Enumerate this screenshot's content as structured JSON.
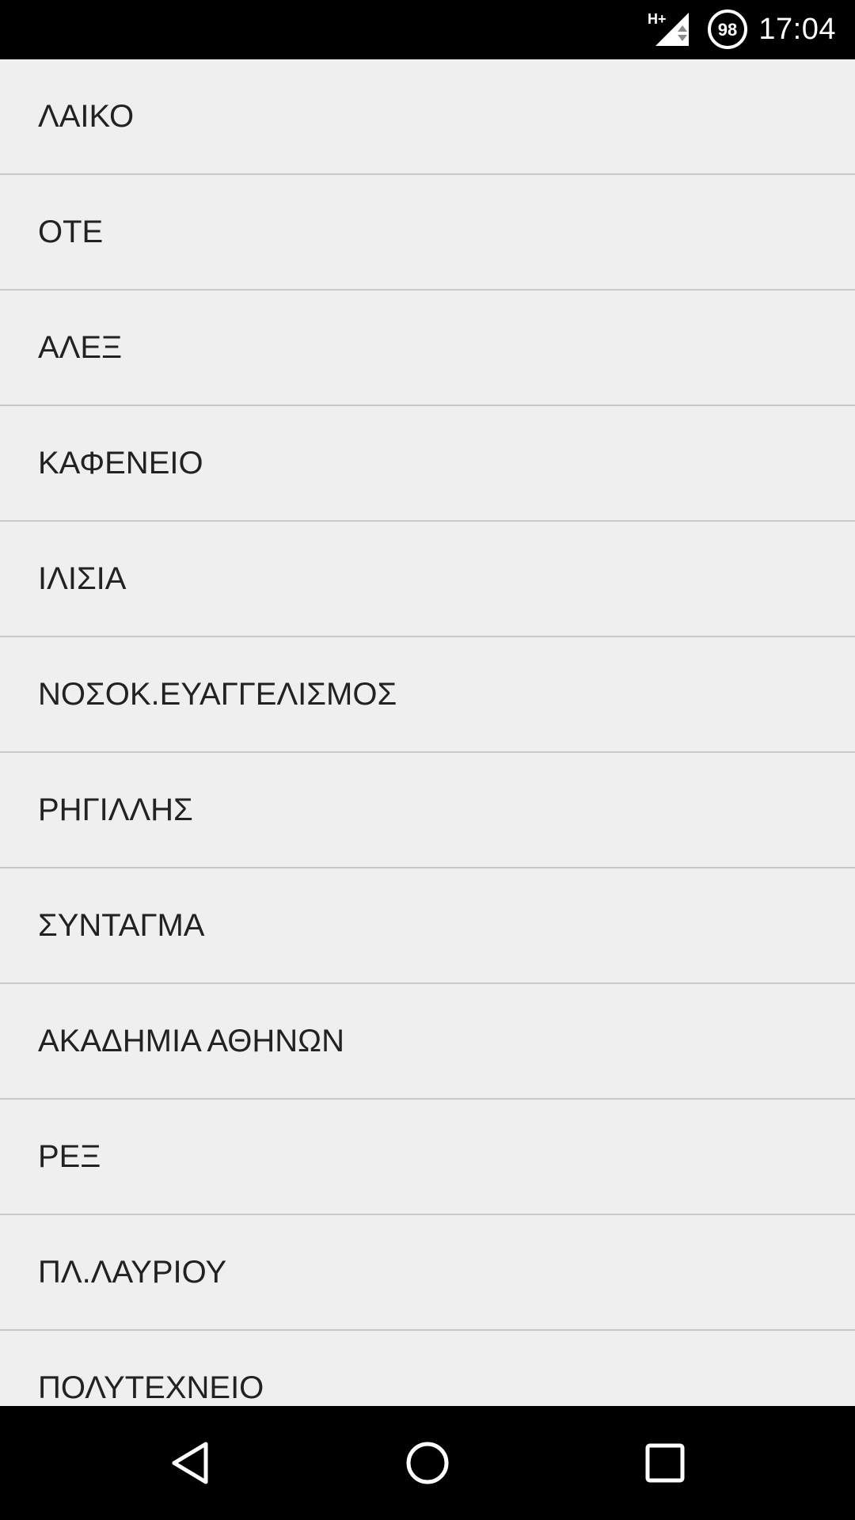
{
  "status_bar": {
    "network_label": "H+",
    "battery_level": "98",
    "time": "17:04",
    "icons": [
      "signal-h-plus-icon",
      "battery-icon"
    ]
  },
  "stations": [
    {
      "label": "ΛΑΙΚΟ"
    },
    {
      "label": "ΟΤΕ"
    },
    {
      "label": "ΑΛΕΞ"
    },
    {
      "label": "ΚΑΦΕΝΕΙΟ"
    },
    {
      "label": "ΙΛΙΣΙΑ"
    },
    {
      "label": "ΝΟΣΟΚ.ΕΥΑΓΓΕΛΙΣΜΟΣ"
    },
    {
      "label": "ΡΗΓΙΛΛΗΣ"
    },
    {
      "label": "ΣΥΝΤΑΓΜΑ"
    },
    {
      "label": "ΑΚΑΔΗΜΙΑ ΑΘΗΝΩΝ"
    },
    {
      "label": "ΡΕΞ"
    },
    {
      "label": "ΠΛ.ΛΑΥΡΙΟΥ"
    },
    {
      "label": "ΠΟΛΥΤΕΧΝΕΙΟ"
    }
  ],
  "nav_bar": {
    "icons": [
      "back-icon",
      "home-icon",
      "recents-icon"
    ]
  },
  "colors": {
    "list_background": "#efefef",
    "divider": "#c9c9c9",
    "text": "#222222",
    "system_bars": "#000000"
  }
}
